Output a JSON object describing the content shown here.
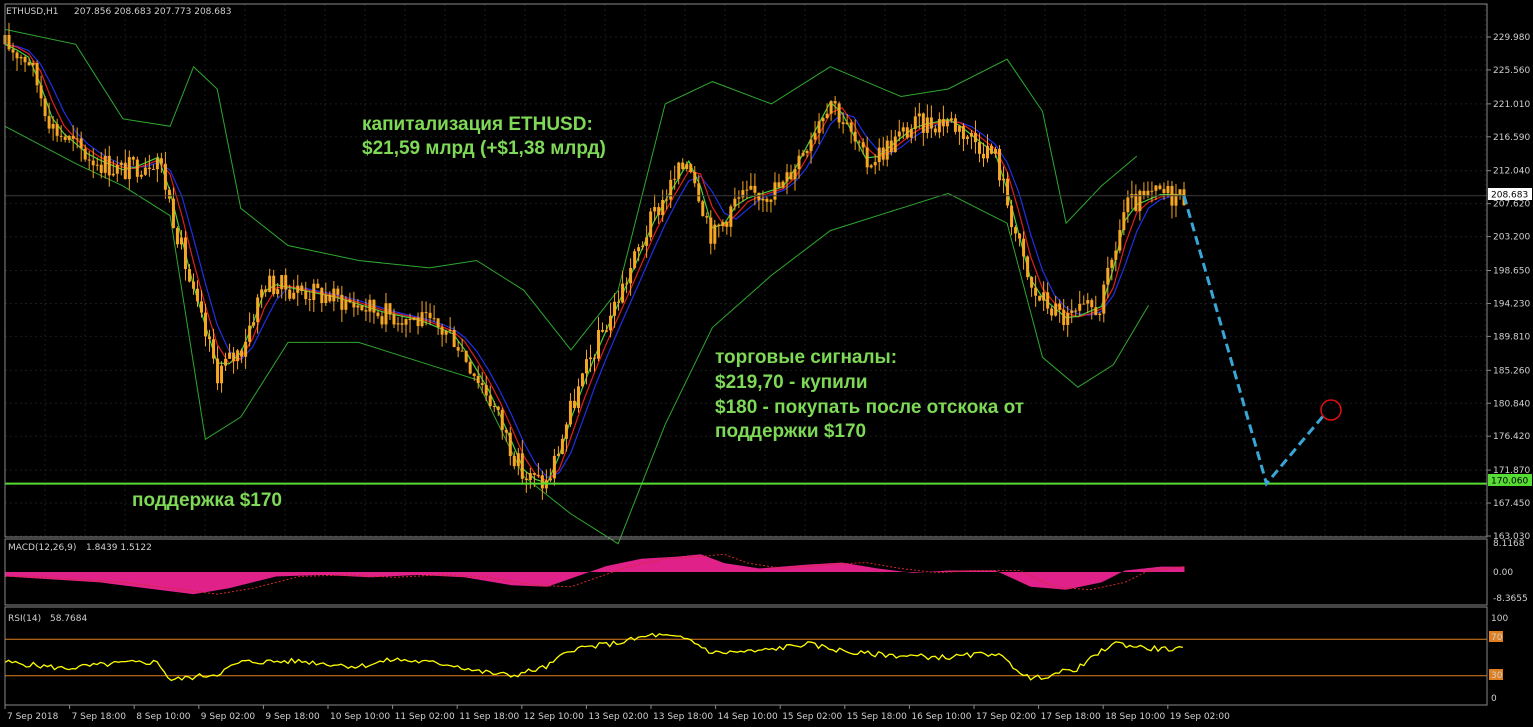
{
  "header": {
    "symbol_tf": "ETHUSD,H1",
    "ohlc": "207.856 208.683 207.773 208.683"
  },
  "colors": {
    "background": "#000000",
    "candle": "#f5a623",
    "bollinger": "#2ea82e",
    "ma_fast": "#41d141",
    "ma_mid": "#e02020",
    "ma_slow": "#1f2fe6",
    "support": "#55dd33",
    "macd": "#e0218a",
    "rsi": "#ffff00",
    "forecast": "#3aa6d6",
    "text_green": "#7ed957"
  },
  "chart_data": [
    {
      "type": "candlestick",
      "panel": "price",
      "symbol": "ETHUSD",
      "timeframe": "H1",
      "ylim": [
        163.03,
        231.5
      ],
      "y_ticks": [
        229.98,
        225.56,
        221.01,
        216.59,
        212.04,
        207.62,
        203.2,
        198.65,
        194.23,
        189.81,
        185.26,
        180.84,
        176.42,
        171.87,
        167.45,
        163.03
      ],
      "y_tick_labels": [
        "229.980",
        "225.560",
        "221.010",
        "216.590",
        "212.040",
        "207.620",
        "203.200",
        "198.650",
        "194.230",
        "189.810",
        "185.260",
        "180.840",
        "176.420",
        "171.870",
        "167.450",
        "163.030"
      ],
      "x_tick_labels": [
        "7 Sep 2018",
        "7 Sep 18:00",
        "8 Sep 10:00",
        "9 Sep 02:00",
        "9 Sep 18:00",
        "10 Sep 10:00",
        "11 Sep 02:00",
        "11 Sep 18:00",
        "12 Sep 10:00",
        "13 Sep 02:00",
        "13 Sep 18:00",
        "14 Sep 10:00",
        "15 Sep 02:00",
        "15 Sep 18:00",
        "16 Sep 10:00",
        "17 Sep 02:00",
        "17 Sep 18:00",
        "18 Sep 10:00",
        "19 Sep 02:00"
      ],
      "close_path": [
        [
          0,
          229
        ],
        [
          0.02,
          227
        ],
        [
          0.04,
          218
        ],
        [
          0.07,
          214
        ],
        [
          0.1,
          212
        ],
        [
          0.13,
          214
        ],
        [
          0.16,
          195
        ],
        [
          0.18,
          185
        ],
        [
          0.2,
          188
        ],
        [
          0.22,
          197
        ],
        [
          0.25,
          196
        ],
        [
          0.28,
          195
        ],
        [
          0.32,
          193
        ],
        [
          0.35,
          192
        ],
        [
          0.38,
          190
        ],
        [
          0.41,
          182
        ],
        [
          0.44,
          171
        ],
        [
          0.46,
          170
        ],
        [
          0.48,
          180
        ],
        [
          0.5,
          188
        ],
        [
          0.52,
          195
        ],
        [
          0.55,
          206
        ],
        [
          0.58,
          214
        ],
        [
          0.6,
          203
        ],
        [
          0.62,
          208
        ],
        [
          0.66,
          210
        ],
        [
          0.7,
          222
        ],
        [
          0.73,
          213
        ],
        [
          0.77,
          218
        ],
        [
          0.8,
          219
        ],
        [
          0.84,
          214
        ],
        [
          0.87,
          196
        ],
        [
          0.9,
          192
        ],
        [
          0.93,
          194
        ],
        [
          0.95,
          207
        ],
        [
          0.98,
          209
        ],
        [
          1.0,
          208.683
        ]
      ],
      "bollinger_upper": [
        [
          0,
          231
        ],
        [
          0.06,
          229
        ],
        [
          0.1,
          219
        ],
        [
          0.14,
          218
        ],
        [
          0.16,
          226
        ],
        [
          0.18,
          223
        ],
        [
          0.2,
          207
        ],
        [
          0.24,
          202
        ],
        [
          0.3,
          200
        ],
        [
          0.36,
          199
        ],
        [
          0.4,
          200
        ],
        [
          0.44,
          196
        ],
        [
          0.48,
          188
        ],
        [
          0.52,
          196
        ],
        [
          0.56,
          221
        ],
        [
          0.6,
          224
        ],
        [
          0.65,
          221
        ],
        [
          0.7,
          226
        ],
        [
          0.76,
          222
        ],
        [
          0.8,
          223
        ],
        [
          0.85,
          227
        ],
        [
          0.88,
          220
        ],
        [
          0.9,
          205
        ],
        [
          0.93,
          210
        ],
        [
          0.96,
          214
        ]
      ],
      "bollinger_lower": [
        [
          0,
          218
        ],
        [
          0.06,
          213
        ],
        [
          0.1,
          210
        ],
        [
          0.14,
          206
        ],
        [
          0.17,
          176
        ],
        [
          0.2,
          179
        ],
        [
          0.24,
          189
        ],
        [
          0.3,
          189
        ],
        [
          0.36,
          186
        ],
        [
          0.4,
          184
        ],
        [
          0.44,
          171
        ],
        [
          0.48,
          166
        ],
        [
          0.52,
          162
        ],
        [
          0.56,
          178
        ],
        [
          0.6,
          191
        ],
        [
          0.65,
          198
        ],
        [
          0.7,
          204
        ],
        [
          0.76,
          207
        ],
        [
          0.8,
          209
        ],
        [
          0.85,
          205
        ],
        [
          0.88,
          187
        ],
        [
          0.91,
          183
        ],
        [
          0.94,
          186
        ],
        [
          0.97,
          194
        ]
      ],
      "support_level": 170.06,
      "support_label": "170.060",
      "last_price_label": "208.683",
      "forecast_path": [
        [
          0,
          208.683
        ],
        [
          0.07,
          170.06
        ],
        [
          0.12,
          179.5
        ]
      ]
    },
    {
      "type": "bar",
      "panel": "macd",
      "indicator": "MACD(12,26,9)",
      "values_label": "1.8439 1.5122",
      "y_tick_labels": [
        "8.1168",
        "0.00",
        "-8.3655"
      ],
      "ylim": [
        -8.3655,
        8.1168
      ],
      "histogram": [
        [
          0,
          -1.5
        ],
        [
          0.08,
          -3.5
        ],
        [
          0.12,
          -5.5
        ],
        [
          0.16,
          -7.5
        ],
        [
          0.19,
          -5.5
        ],
        [
          0.23,
          -1.5
        ],
        [
          0.27,
          -1.0
        ],
        [
          0.31,
          -1.8
        ],
        [
          0.35,
          -1.0
        ],
        [
          0.39,
          -1.8
        ],
        [
          0.43,
          -4.5
        ],
        [
          0.46,
          -5.0
        ],
        [
          0.49,
          -0.8
        ],
        [
          0.51,
          2.0
        ],
        [
          0.54,
          4.5
        ],
        [
          0.57,
          5.2
        ],
        [
          0.59,
          6.0
        ],
        [
          0.61,
          3.0
        ],
        [
          0.64,
          1.2
        ],
        [
          0.68,
          2.5
        ],
        [
          0.71,
          3.2
        ],
        [
          0.74,
          1.2
        ],
        [
          0.77,
          -0.3
        ],
        [
          0.8,
          0.5
        ],
        [
          0.84,
          0.5
        ],
        [
          0.87,
          -5.0
        ],
        [
          0.9,
          -6.0
        ],
        [
          0.93,
          -3.5
        ],
        [
          0.95,
          0.5
        ],
        [
          0.98,
          1.8
        ],
        [
          1.0,
          1.8439
        ]
      ]
    },
    {
      "type": "line",
      "panel": "rsi",
      "indicator": "RSI(14)",
      "value_label": "58.7684",
      "y_tick_labels": [
        "100",
        "70",
        "30",
        "0"
      ],
      "levels": [
        70,
        30
      ],
      "ylim": [
        0,
        100
      ],
      "series": [
        {
          "values": [
            [
              0,
              45
            ],
            [
              0.05,
              38
            ],
            [
              0.1,
              44
            ],
            [
              0.13,
              45
            ],
            [
              0.14,
              25
            ],
            [
              0.18,
              32
            ],
            [
              0.2,
              45
            ],
            [
              0.25,
              46
            ],
            [
              0.3,
              40
            ],
            [
              0.33,
              48
            ],
            [
              0.38,
              42
            ],
            [
              0.4,
              35
            ],
            [
              0.43,
              30
            ],
            [
              0.46,
              40
            ],
            [
              0.48,
              59
            ],
            [
              0.52,
              66
            ],
            [
              0.55,
              75
            ],
            [
              0.58,
              70
            ],
            [
              0.6,
              55
            ],
            [
              0.64,
              57
            ],
            [
              0.68,
              65
            ],
            [
              0.72,
              55
            ],
            [
              0.76,
              52
            ],
            [
              0.8,
              50
            ],
            [
              0.84,
              55
            ],
            [
              0.87,
              26
            ],
            [
              0.91,
              38
            ],
            [
              0.94,
              66
            ],
            [
              0.97,
              60
            ],
            [
              1.0,
              58.77
            ]
          ]
        }
      ]
    }
  ],
  "annotations": {
    "cap_line1": "капитализация ETHUSD:",
    "cap_line2": "$21,59 млрд (+$1,38 млрд)",
    "sig_line1": "торговые сигналы:",
    "sig_line2": "$219,70 - купили",
    "sig_line3": "$180 - покупать после отскока от",
    "sig_line4": "поддержки $170",
    "support_text": "поддержка $170"
  }
}
